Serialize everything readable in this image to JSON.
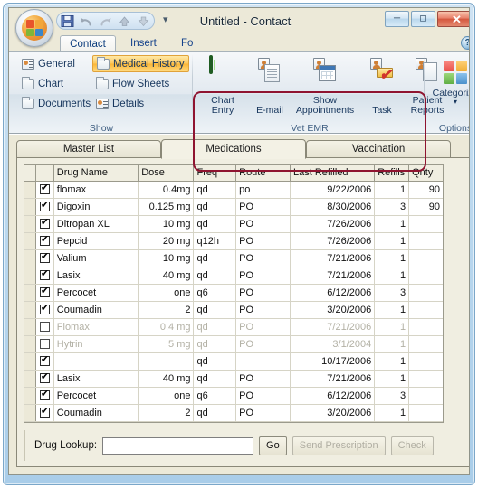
{
  "window": {
    "title": "Untitled - Contact",
    "controls": {
      "minimize": "—",
      "maximize": "❐",
      "close": "✕"
    }
  },
  "quick_access": {
    "items": [
      {
        "name": "save-icon",
        "label": "Save"
      },
      {
        "name": "undo-icon",
        "label": "Undo"
      },
      {
        "name": "redo-icon",
        "label": "Redo"
      },
      {
        "name": "previous-item-icon",
        "label": "Previous Item"
      },
      {
        "name": "next-item-icon",
        "label": "Next Item"
      }
    ],
    "customize": "▾"
  },
  "ribbon": {
    "tabs": [
      {
        "label": "Contact",
        "active": true
      },
      {
        "label": "Insert",
        "active": false
      },
      {
        "label": "Fo",
        "active": false
      }
    ],
    "help_label": "?",
    "groups": {
      "show": {
        "label": "Show",
        "items": [
          {
            "label": "General",
            "icon": "contact-card-icon",
            "selected": false
          },
          {
            "label": "Medical History",
            "icon": "folder-icon",
            "selected": true
          },
          {
            "label": "Chart",
            "icon": "folder-icon",
            "selected": false
          },
          {
            "label": "Flow Sheets",
            "icon": "folder-icon",
            "selected": false
          },
          {
            "label": "Documents",
            "icon": "folder-icon",
            "selected": false
          },
          {
            "label": "Details",
            "icon": "contact-card-icon",
            "selected": false
          }
        ]
      },
      "vet_emr": {
        "label": "Vet EMR",
        "items": [
          {
            "label_line1": "Chart",
            "label_line2": "Entry",
            "icon": "green-book-icon"
          },
          {
            "label_line1": "E-mail",
            "label_line2": "",
            "icon": "email-contact-icon"
          },
          {
            "label_line1": "Show",
            "label_line2": "Appointments",
            "icon": "calendar-contact-icon"
          },
          {
            "label_line1": "Task",
            "label_line2": "",
            "icon": "task-check-icon"
          },
          {
            "label_line1": "Patient",
            "label_line2": "Reports",
            "icon": "patient-report-icon"
          }
        ]
      },
      "options": {
        "label": "Options",
        "categorize_label": "Categorize",
        "categorize_arrow": "▾",
        "category_colors": [
          "#e8504a",
          "#f0ad35",
          "#5fae44",
          "#4a90cb"
        ]
      }
    }
  },
  "annotation": {
    "color": "#8f1430",
    "target": "Vet EMR group"
  },
  "tabs": [
    {
      "label": "Master List",
      "active": false
    },
    {
      "label": "Medications",
      "active": true
    },
    {
      "label": "Vaccination",
      "active": false
    }
  ],
  "grid": {
    "columns": [
      "",
      "",
      "Drug Name",
      "Dose",
      "Freq",
      "Route",
      "Last Refilled",
      "Refills",
      "Qnty"
    ],
    "rows": [
      {
        "checked": true,
        "dim": false,
        "drug": "flomax",
        "dose": "0.4mg",
        "freq": "qd",
        "route": "po",
        "refilled": "9/22/2006",
        "refills": "1",
        "qnty": "90"
      },
      {
        "checked": true,
        "dim": false,
        "drug": "Digoxin",
        "dose": "0.125 mg",
        "freq": "qd",
        "route": "PO",
        "refilled": "8/30/2006",
        "refills": "3",
        "qnty": "90"
      },
      {
        "checked": true,
        "dim": false,
        "drug": "Ditropan XL",
        "dose": "10 mg",
        "freq": "qd",
        "route": "PO",
        "refilled": "7/26/2006",
        "refills": "1",
        "qnty": ""
      },
      {
        "checked": true,
        "dim": false,
        "drug": "Pepcid",
        "dose": "20 mg",
        "freq": "q12h",
        "route": "PO",
        "refilled": "7/26/2006",
        "refills": "1",
        "qnty": ""
      },
      {
        "checked": true,
        "dim": false,
        "drug": "Valium",
        "dose": "10 mg",
        "freq": "qd",
        "route": "PO",
        "refilled": "7/21/2006",
        "refills": "1",
        "qnty": ""
      },
      {
        "checked": true,
        "dim": false,
        "drug": "Lasix",
        "dose": "40 mg",
        "freq": "qd",
        "route": "PO",
        "refilled": "7/21/2006",
        "refills": "1",
        "qnty": ""
      },
      {
        "checked": true,
        "dim": false,
        "drug": "Percocet",
        "dose": "one",
        "freq": "q6",
        "route": "PO",
        "refilled": "6/12/2006",
        "refills": "3",
        "qnty": ""
      },
      {
        "checked": true,
        "dim": false,
        "drug": "Coumadin",
        "dose": "2",
        "freq": "qd",
        "route": "PO",
        "refilled": "3/20/2006",
        "refills": "1",
        "qnty": ""
      },
      {
        "checked": false,
        "dim": true,
        "drug": "Flomax",
        "dose": "0.4 mg",
        "freq": "qd",
        "route": "PO",
        "refilled": "7/21/2006",
        "refills": "1",
        "qnty": ""
      },
      {
        "checked": false,
        "dim": true,
        "drug": "Hytrin",
        "dose": "5 mg",
        "freq": "qd",
        "route": "PO",
        "refilled": "3/1/2004",
        "refills": "1",
        "qnty": ""
      },
      {
        "checked": true,
        "dim": false,
        "drug": "",
        "dose": "",
        "freq": "qd",
        "route": "",
        "refilled": "10/17/2006",
        "refills": "1",
        "qnty": ""
      },
      {
        "checked": true,
        "dim": false,
        "drug": "Lasix",
        "dose": "40 mg",
        "freq": "qd",
        "route": "PO",
        "refilled": "7/21/2006",
        "refills": "1",
        "qnty": ""
      },
      {
        "checked": true,
        "dim": false,
        "drug": "Percocet",
        "dose": "one",
        "freq": "q6",
        "route": "PO",
        "refilled": "6/12/2006",
        "refills": "3",
        "qnty": ""
      },
      {
        "checked": true,
        "dim": false,
        "drug": "Coumadin",
        "dose": "2",
        "freq": "qd",
        "route": "PO",
        "refilled": "3/20/2006",
        "refills": "1",
        "qnty": ""
      }
    ]
  },
  "bottom_bar": {
    "lookup_label": "Drug Lookup:",
    "lookup_value": "",
    "lookup_placeholder": "",
    "go_label": "Go",
    "send_prescription_label": "Send Prescription",
    "check_label": "Check"
  }
}
